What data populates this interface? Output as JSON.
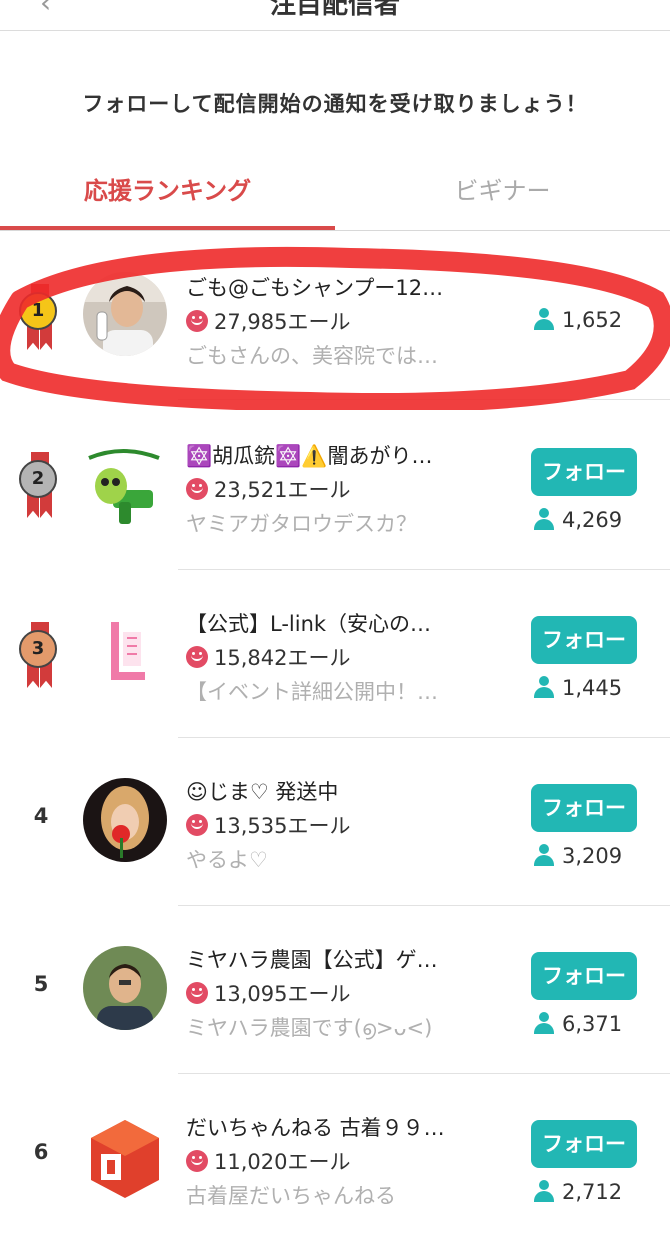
{
  "header": {
    "title": "注目配信者",
    "back_icon": "chevron-left-icon"
  },
  "banner": "フォローして配信開始の通知を受け取りましょう！",
  "tabs": [
    {
      "label": "応援ランキング",
      "active": true
    },
    {
      "label": "ビギナー",
      "active": false
    }
  ],
  "colors": {
    "accent": "#d94a4a",
    "follow": "#22b7b4",
    "heart": "#e24b64",
    "highlight": "#ee2a2a"
  },
  "ranking": [
    {
      "rank": "1",
      "medal": "gold",
      "name": "ごも@ごもシャンプー12…",
      "yell": "27,985エール",
      "desc": "ごもさんの、美容院では…",
      "followers": "1,652",
      "follow_label": ""
    },
    {
      "rank": "2",
      "medal": "silver",
      "name": "🔯胡瓜銃🔯⚠️闇あがり…",
      "yell": "23,521エール",
      "desc": "ヤミアガタロウデスカ？",
      "followers": "4,269",
      "follow_label": "フォロー"
    },
    {
      "rank": "3",
      "medal": "bronze",
      "name": "【公式】L-link（安心の…",
      "yell": "15,842エール",
      "desc": "【イベント詳細公開中！…",
      "followers": "1,445",
      "follow_label": "フォロー"
    },
    {
      "rank": "4",
      "medal": "",
      "name": "☺じま♡ 発送中",
      "yell": "13,535エール",
      "desc": "やるよ♡",
      "followers": "3,209",
      "follow_label": "フォロー"
    },
    {
      "rank": "5",
      "medal": "",
      "name": "ミヤハラ農園【公式】ゲ…",
      "yell": "13,095エール",
      "desc": "ミヤハラ農園です(൭>ᴗ<)",
      "followers": "6,371",
      "follow_label": "フォロー"
    },
    {
      "rank": "6",
      "medal": "",
      "name": "だいちゃんねる 古着９９…",
      "yell": "11,020エール",
      "desc": "古着屋だいちゃんねる ￼",
      "followers": "2,712",
      "follow_label": "フォロー"
    }
  ]
}
